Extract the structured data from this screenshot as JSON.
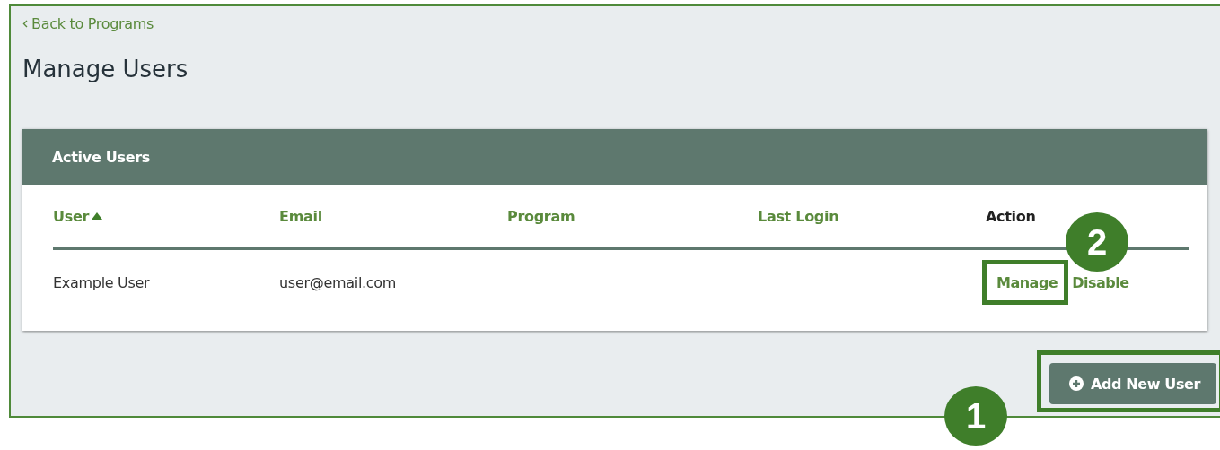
{
  "back_link": {
    "label": "Back to Programs"
  },
  "title": "Manage Users",
  "table": {
    "title": "Active Users",
    "columns": [
      {
        "label": "User",
        "sortable": true,
        "sorted": true
      },
      {
        "label": "Email",
        "sortable": true,
        "sorted": false
      },
      {
        "label": "Program",
        "sortable": true,
        "sorted": false
      },
      {
        "label": "Last Login",
        "sortable": true,
        "sorted": false
      },
      {
        "label": "Action",
        "sortable": false,
        "sorted": false
      }
    ],
    "rows": [
      {
        "user": "Example User",
        "email": "user@email.com",
        "actions": [
          {
            "label": "Manage",
            "highlighted": true
          },
          {
            "label": "Disable",
            "highlighted": false
          }
        ]
      }
    ]
  },
  "add_button": {
    "label": "Add New User",
    "highlighted": true
  },
  "callouts": [
    {
      "number": "1"
    },
    {
      "number": "2"
    }
  ]
}
